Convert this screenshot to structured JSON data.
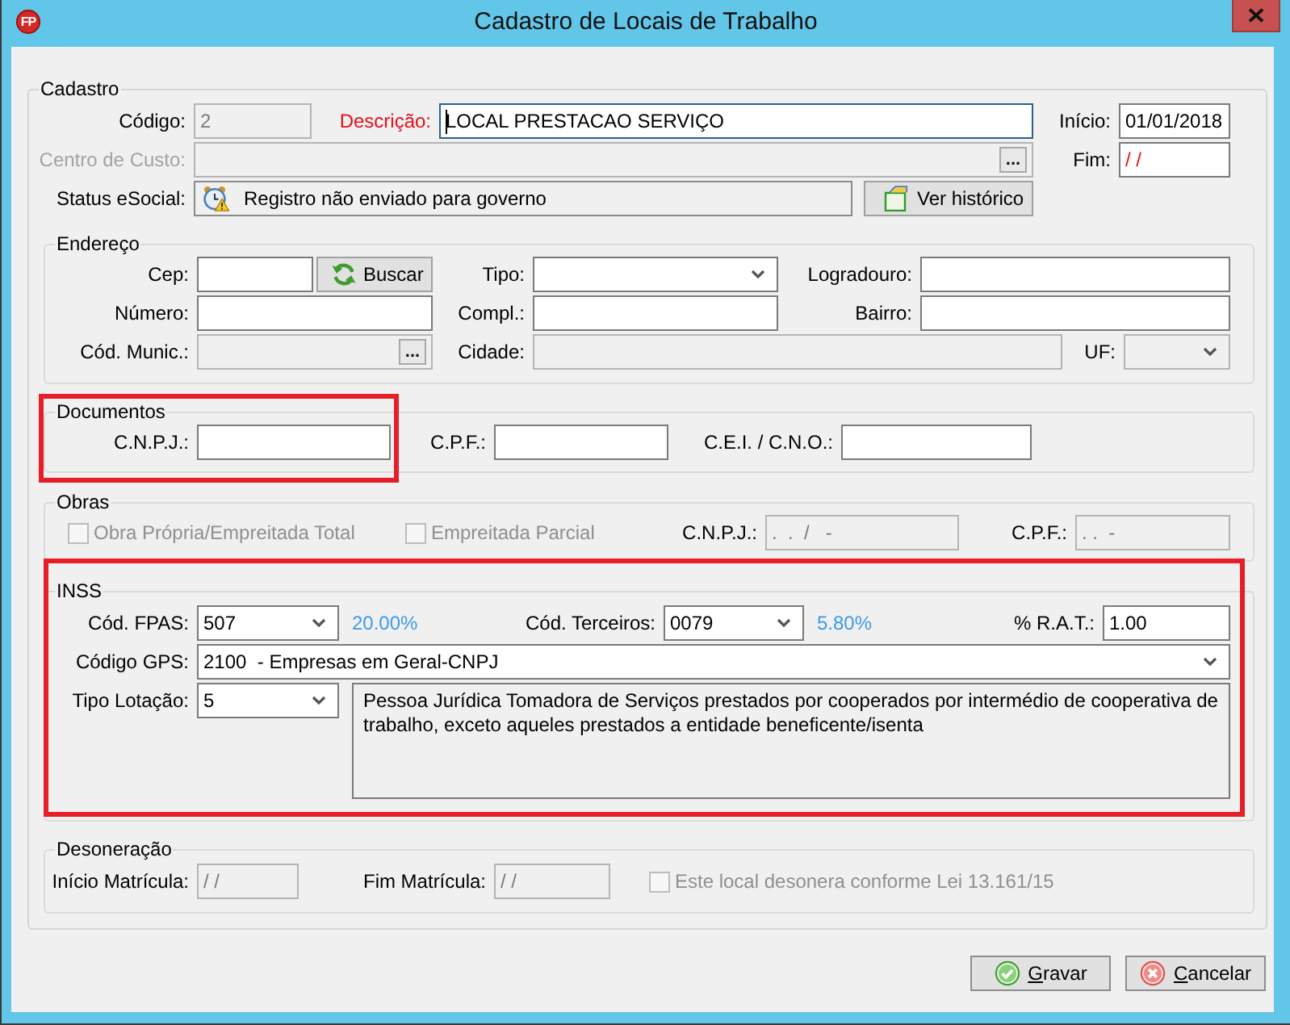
{
  "window": {
    "title": "Cadastro de Locais de Trabalho",
    "logo_text": "FP"
  },
  "cadastro": {
    "legend": "Cadastro",
    "codigo": {
      "label": "Código:",
      "value": "2",
      "readonly": true
    },
    "descricao": {
      "label": "Descrição:",
      "value": "LOCAL PRESTACAO SERVIÇO",
      "required": true,
      "focused": true
    },
    "inicio": {
      "label": "Início:",
      "value": "01/01/2018"
    },
    "centro_custo": {
      "label": "Centro de Custo:",
      "button": "...",
      "disabled": true
    },
    "fim": {
      "label": "Fim:",
      "value": "/ /",
      "invalid": true
    },
    "status_esocial": {
      "label": "Status eSocial:",
      "value": "Registro não enviado para governo"
    },
    "ver_historico": {
      "label": "Ver histórico"
    }
  },
  "endereco": {
    "legend": "Endereço",
    "cep": {
      "label": "Cep:"
    },
    "buscar": {
      "label": "Buscar"
    },
    "tipo": {
      "label": "Tipo:"
    },
    "logradouro": {
      "label": "Logradouro:"
    },
    "numero": {
      "label": "Número:"
    },
    "compl": {
      "label": "Compl.:"
    },
    "bairro": {
      "label": "Bairro:"
    },
    "cod_munic": {
      "label": "Cód. Munic.:",
      "button": "...",
      "readonly": true
    },
    "cidade": {
      "label": "Cidade:",
      "readonly": true
    },
    "uf": {
      "label": "UF:",
      "readonly": true
    }
  },
  "documentos": {
    "legend": "Documentos",
    "highlighted": true,
    "cnpj": {
      "label": "C.N.P.J.:"
    },
    "cpf": {
      "label": "C.P.F.:"
    },
    "cei_cno": {
      "label": "C.E.I. / C.N.O.:"
    }
  },
  "obras": {
    "legend": "Obras",
    "propria": {
      "label": "Obra Própria/Empreitada Total",
      "checked": false,
      "disabled": true
    },
    "parcial": {
      "label": "Empreitada Parcial",
      "checked": false,
      "disabled": true
    },
    "cnpj": {
      "label": "C.N.P.J.:",
      "value": ".  .  /   -",
      "readonly": true
    },
    "cpf": {
      "label": "C.P.F.:",
      "value": ". .  -",
      "readonly": true
    }
  },
  "inss": {
    "legend": "INSS",
    "highlighted": true,
    "fpas": {
      "label": "Cód. FPAS:",
      "value": "507",
      "rate": "20.00%"
    },
    "terceiros": {
      "label": "Cód. Terceiros:",
      "value": "0079",
      "rate": "5.80%"
    },
    "rat": {
      "label": "% R.A.T.:",
      "value": "1.00"
    },
    "gps": {
      "label": "Código GPS:",
      "value": "2100  - Empresas em Geral-CNPJ"
    },
    "tipo_lotacao": {
      "label": "Tipo Lotação:",
      "value": "5",
      "description": "Pessoa Jurídica Tomadora de Serviços prestados por cooperados por intermédio de cooperativa de trabalho, exceto aqueles prestados a entidade beneficente/isenta"
    }
  },
  "desoneracao": {
    "legend": "Desoneração",
    "inicio_matricula": {
      "label": "Início Matrícula:",
      "value": "/ /",
      "readonly": true
    },
    "fim_matricula": {
      "label": "Fim Matrícula:",
      "value": "/ /",
      "readonly": true
    },
    "desonera": {
      "label": "Este local desonera conforme Lei 13.161/15",
      "checked": false,
      "disabled": true
    }
  },
  "buttons": [
    {
      "label": "Gravar",
      "kind": "confirm"
    },
    {
      "label": "Cancelar",
      "kind": "cancel"
    }
  ]
}
